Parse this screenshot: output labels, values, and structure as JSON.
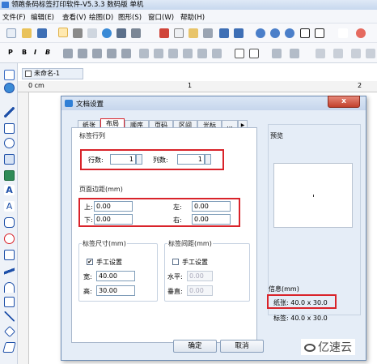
{
  "window": {
    "title": "领跑条码标签打印软件-V5.3.3 数码版 单机"
  },
  "menu": {
    "items": [
      "文件(F)",
      "编辑(E)",
      "查看(V)",
      "绘图(D)",
      "图形(S)",
      "窗口(W)",
      "帮助(H)"
    ]
  },
  "toolbar2": {
    "p": "P",
    "b": "B",
    "i": "I",
    "b2": "B"
  },
  "doc_tab": {
    "label": "未命名-1"
  },
  "ruler": {
    "zero": "0 cm",
    "one": "1",
    "two": "2"
  },
  "dialog": {
    "title": "文档设置",
    "close": "x",
    "tabs": [
      "纸张",
      "布局",
      "顺序",
      "页码",
      "区间",
      "光标",
      "..."
    ],
    "rows_cols": {
      "group": "标签行列",
      "rows_label": "行数:",
      "rows_value": "1",
      "cols_label": "列数:",
      "cols_value": "1"
    },
    "margins": {
      "group": "页面边距(mm)",
      "top_label": "上:",
      "top_value": "0.00",
      "left_label": "左:",
      "left_value": "0.00",
      "bottom_label": "下:",
      "bottom_value": "0.00",
      "right_label": "右:",
      "right_value": "0.00"
    },
    "size": {
      "group": "标签尺寸(mm)",
      "manual_label": "手工设置",
      "manual_checked": "✔",
      "width_label": "宽:",
      "width_value": "40.00",
      "height_label": "高:",
      "height_value": "30.00"
    },
    "spacing": {
      "group": "标签间距(mm)",
      "manual_label": "手工设置",
      "h_label": "水平:",
      "h_value": "0.00",
      "v_label": "垂直:",
      "v_value": "0.00"
    },
    "preview": {
      "label": "预览"
    },
    "info": {
      "group": "信息(mm)",
      "paper": "纸张: 40.0 x 30.0",
      "label": "标签: 40.0 x 30.0"
    },
    "ok": "确定",
    "cancel": "取消"
  },
  "watermark": "亿速云",
  "colors": {
    "highlight": "#d9232a",
    "accent": "#2f7fd6"
  }
}
